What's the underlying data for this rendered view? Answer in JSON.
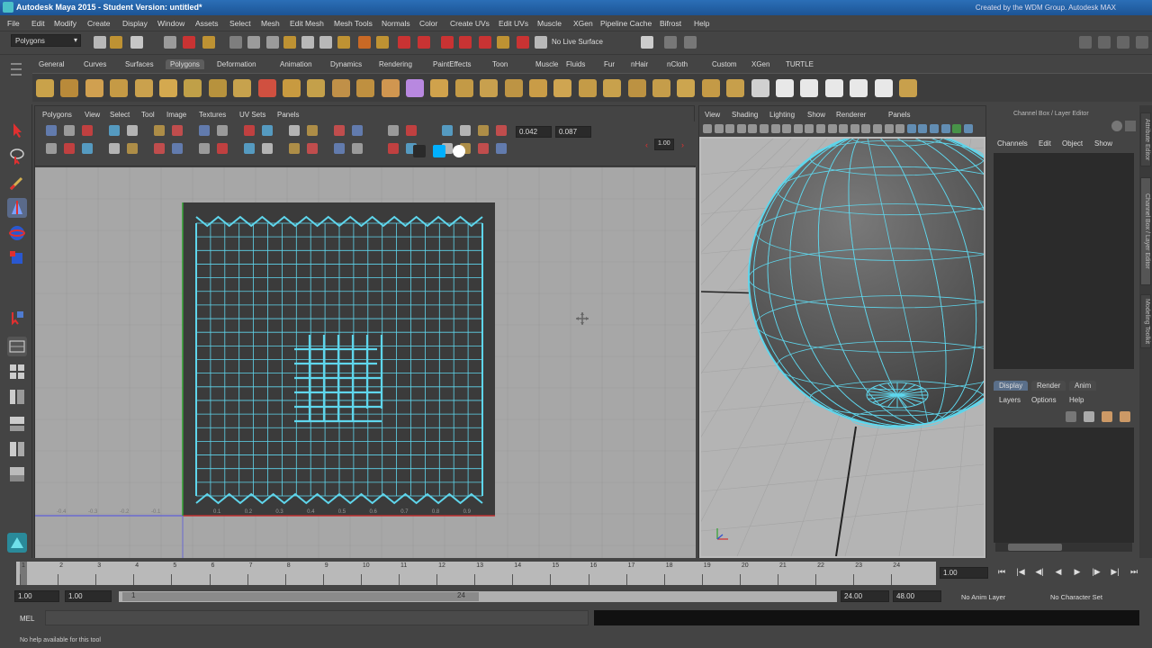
{
  "window": {
    "title": "Autodesk Maya 2015 - Student Version: untitled*",
    "credit": "Created by the WDM Group. Autodesk MAX"
  },
  "menubar": [
    "File",
    "Edit",
    "Modify",
    "Create",
    "Display",
    "Window",
    "Assets",
    "Select",
    "Mesh",
    "Edit Mesh",
    "Mesh Tools",
    "Normals",
    "Color",
    "Create UVs",
    "Edit UVs",
    "Muscle",
    "XGen",
    "Pipeline Cache",
    "Bifrost",
    "Help"
  ],
  "statusline": {
    "menuset": "Polygons",
    "live_surface": "No Live Surface"
  },
  "shelf": {
    "tabs": [
      "General",
      "Curves",
      "Surfaces",
      "Polygons",
      "Deformation",
      "Animation",
      "Dynamics",
      "Rendering",
      "PaintEffects",
      "Toon",
      "Muscle",
      "Fluids",
      "Fur",
      "nHair",
      "nCloth",
      "Custom",
      "XGen",
      "TURTLE"
    ],
    "active_tab": "Polygons"
  },
  "uv_editor": {
    "menu": [
      "Polygons",
      "View",
      "Select",
      "Tool",
      "Image",
      "Textures",
      "UV Sets",
      "Panels"
    ],
    "u_value": "0.042",
    "v_value": "0.087",
    "scale_value": "1.00",
    "ruler_labels": [
      "0.1",
      "0.2",
      "0.3",
      "0.4",
      "0.5",
      "0.6",
      "0.7",
      "0.8",
      "0.9"
    ],
    "neg_labels": [
      "-0.4",
      "-0.3",
      "-0.2",
      "-0.1"
    ]
  },
  "viewport": {
    "menu": [
      "View",
      "Shading",
      "Lighting",
      "Show",
      "Renderer",
      "Panels"
    ]
  },
  "channel_box": {
    "title": "Channel Box / Layer Editor",
    "menu": [
      "Channels",
      "Edit",
      "Object",
      "Show"
    ],
    "layer_tabs": [
      "Display",
      "Render",
      "Anim"
    ],
    "layer_menu": [
      "Layers",
      "Options",
      "Help"
    ]
  },
  "side_tabs": [
    "Attribute Editor",
    "Channel Box / Layer Editor",
    "Modeling Toolkit"
  ],
  "timeline": {
    "ticks": [
      "1",
      "2",
      "3",
      "4",
      "5",
      "6",
      "7",
      "8",
      "9",
      "10",
      "11",
      "12",
      "13",
      "14",
      "15",
      "16",
      "17",
      "18",
      "19",
      "20",
      "21",
      "22",
      "23",
      "24"
    ],
    "current_frame": "1.00",
    "range_start": "1.00",
    "playback_start": "1.00",
    "slider_start": "1",
    "slider_end": "24",
    "playback_end": "24.00",
    "range_end": "48.00",
    "anim_layer": "No Anim Layer",
    "char_set": "No Character Set"
  },
  "command_line": {
    "label": "MEL"
  },
  "help_line": {
    "text": "No help available for this tool"
  },
  "colors": {
    "uv_wire": "#5fd6ec",
    "panel_bg": "#444444",
    "title_blue": "#1c5495"
  }
}
